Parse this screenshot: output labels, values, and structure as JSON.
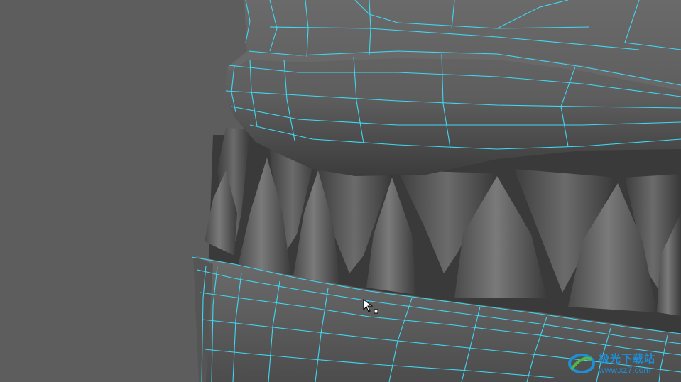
{
  "app": {
    "viewport_label": "3D modeling viewport - perspective view",
    "mode": "object-mode",
    "selection_highlight_color": "#3fd7f2",
    "background_color": "#5d5d5d"
  },
  "model": {
    "name": "mouth-with-teeth",
    "parts": [
      "upper-gum",
      "upper-teeth",
      "lower-teeth",
      "lower-gum"
    ]
  },
  "cursor": {
    "icon": "move-pointer-icon"
  },
  "watermark": {
    "chinese_text": "极光下载站",
    "url_text": "www.xz7.com",
    "color": "#1e8fd6"
  }
}
